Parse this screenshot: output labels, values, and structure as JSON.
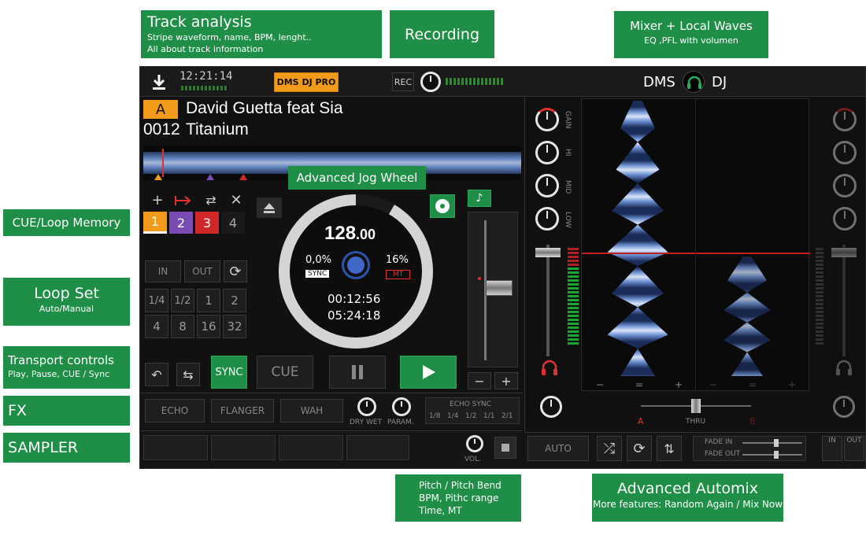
{
  "callouts": {
    "track_analysis": {
      "title": "Track analysis",
      "line1": "Stripe waveform, name, BPM, lenght..",
      "line2": "All about track information"
    },
    "recording": {
      "title": "Recording"
    },
    "mixer": {
      "title": "Mixer + Local Waves",
      "line1": "EQ ,PFL with volumen"
    },
    "jog": {
      "title": "Advanced Jog Wheel"
    },
    "cue_loop": {
      "title": "CUE/Loop Memory"
    },
    "loop_set": {
      "title": "Loop Set",
      "line1": "Auto/Manual"
    },
    "transport": {
      "title": "Transport controls",
      "line1": "Play, Pause, CUE / Sync"
    },
    "fx": {
      "title": "FX"
    },
    "sampler": {
      "title": "SAMPLER"
    },
    "pitch": {
      "line1": "Pitch / Pitch Bend",
      "line2": "BPM, Pithc range",
      "line3": "Time, MT"
    },
    "automix": {
      "title": "Advanced Automix",
      "line1": "More features: Random Again / Mix Now"
    }
  },
  "topbar": {
    "clock": "12:21:14",
    "brand_button": "DMS DJ PRO",
    "rec_label": "REC",
    "logo_left": "DMS",
    "logo_right": "DJ"
  },
  "deck": {
    "letter": "A",
    "artist": "David Guetta feat Sia",
    "track_number": "0012",
    "title": "Titanium"
  },
  "cue_points": [
    "1",
    "2",
    "3",
    "4"
  ],
  "loop": {
    "in_label": "IN",
    "out_label": "OUT",
    "sizes_row1": [
      "1/4",
      "1/2",
      "1",
      "2"
    ],
    "sizes_row2": [
      "4",
      "8",
      "16",
      "32"
    ]
  },
  "jog": {
    "bpm": "128",
    "bpm_decimal": ".00",
    "pitch": "0,0%",
    "range": "16%",
    "sync_tag": "SYNC",
    "mt_tag": "MT",
    "elapsed": "00:12:56",
    "remaining": "05:24:18"
  },
  "transport": {
    "sync": "SYNC",
    "cue": "CUE",
    "pause_icon": "pause-icon",
    "play_icon": "play-icon"
  },
  "fx": {
    "buttons": [
      "ECHO",
      "FLANGER",
      "WAH"
    ],
    "dry_wet": "DRY WET",
    "param": "PARAM.",
    "echo_sync": "ECHO SYNC",
    "beat_fractions": [
      "1/8",
      "1/4",
      "1/2",
      "1/1",
      "2/1"
    ]
  },
  "sampler": {
    "vol": "VOL."
  },
  "mixer": {
    "eq_labels": [
      "GAIN",
      "HI",
      "MID",
      "LOW"
    ],
    "wave_scale_left": [
      "−",
      "=",
      "+"
    ],
    "wave_scale_right": [
      "−",
      "=",
      "+"
    ],
    "crossfader_label": "THRU",
    "side_a": "A",
    "side_b": "B"
  },
  "automix": {
    "auto": "AUTO",
    "fade_in": "FADE IN",
    "fade_out": "FADE OUT",
    "in": "IN",
    "out": "OUT"
  },
  "colors": {
    "accent_green": "#1f8f48",
    "deck_orange": "#f29b1a",
    "cue2_purple": "#7b4bb5",
    "cue3_red": "#d02828",
    "waveform_blue": "#6a8fd0"
  }
}
